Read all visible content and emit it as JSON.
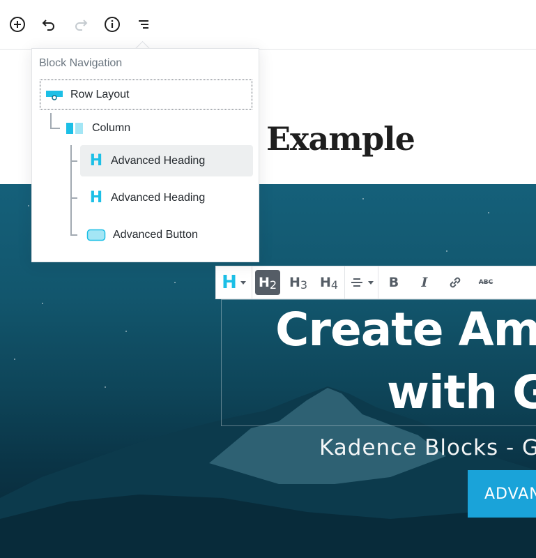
{
  "toolbar": {
    "add_icon": "plus-circle-icon",
    "undo_icon": "undo-icon",
    "redo_icon": "redo-icon",
    "info_icon": "info-icon",
    "nav_icon": "block-navigation-icon"
  },
  "post": {
    "title_visible": "Example"
  },
  "block_navigation": {
    "title": "Block Navigation",
    "items": [
      {
        "label": "Row Layout",
        "icon": "row-layout-icon"
      },
      {
        "label": "Column",
        "icon": "column-icon"
      },
      {
        "label": "Advanced Heading",
        "icon": "heading-icon",
        "selected": true
      },
      {
        "label": "Advanced Heading",
        "icon": "heading-icon"
      },
      {
        "label": "Advanced Button",
        "icon": "button-icon"
      }
    ]
  },
  "format_toolbar": {
    "block_type_glyph": "H",
    "h2": "H2",
    "h3": "H3",
    "h4": "H4",
    "bold": "B",
    "italic": "I",
    "strike": "ABC",
    "h2_level": "2",
    "h3_level": "3",
    "h4_level": "4",
    "h_letter": "H"
  },
  "hero": {
    "heading_line1": "Create Am",
    "heading_line2": "with G",
    "subtitle": "Kadence Blocks - Gu",
    "button": "ADVAN"
  },
  "colors": {
    "accent": "#1cbfe6",
    "button_bg": "#1aa3d9",
    "hero_dark": "#0a3446"
  }
}
